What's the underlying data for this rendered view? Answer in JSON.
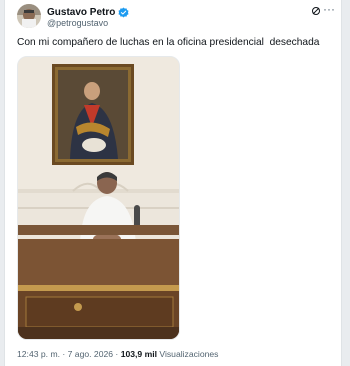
{
  "author": {
    "name": "Gustavo Petro",
    "handle": "@petrogustavo",
    "verified_color": "#1d9bf0"
  },
  "tweet": {
    "text": "Con mi compañero de luchas en la oficina presidencial  desechada",
    "media_icon": "photo-man-at-desk"
  },
  "footer": {
    "time": "12:43 p. m.",
    "sep1": " · ",
    "date": "7 ago. 2026",
    "sep2": " · ",
    "views_count": "103,9 mil",
    "views_label": " Visualizaciones"
  },
  "icons": {
    "grok": "grok-icon",
    "more": "more-icon"
  }
}
